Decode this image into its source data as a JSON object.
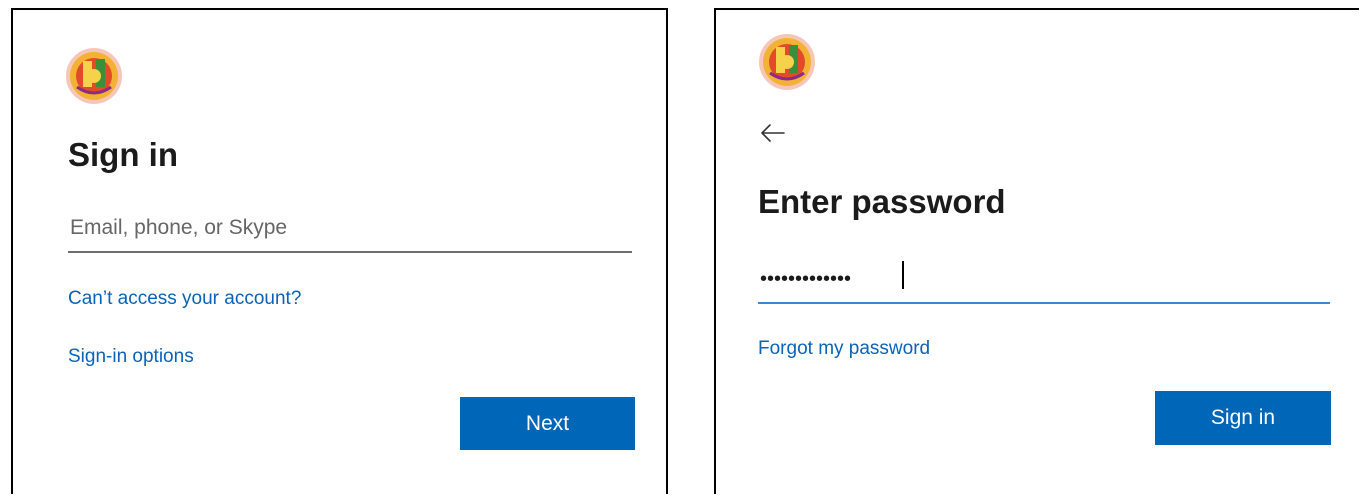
{
  "brand": {
    "logo_icon": "city-seal-icon",
    "primary_color": "#0067b8",
    "link_color": "#0a63b8",
    "focus_color": "#3d86d6"
  },
  "left_panel": {
    "title": "Sign in",
    "email_input": {
      "placeholder": "Email, phone, or Skype",
      "value": ""
    },
    "cant_access_link": "Can’t access your account?",
    "signin_options_link": "Sign-in options",
    "next_button": "Next"
  },
  "right_panel": {
    "back_icon": "back-arrow-icon",
    "title": "Enter password",
    "password_input": {
      "value": "•••••••••••••"
    },
    "forgot_password_link": "Forgot my password",
    "signin_button": "Sign in"
  }
}
